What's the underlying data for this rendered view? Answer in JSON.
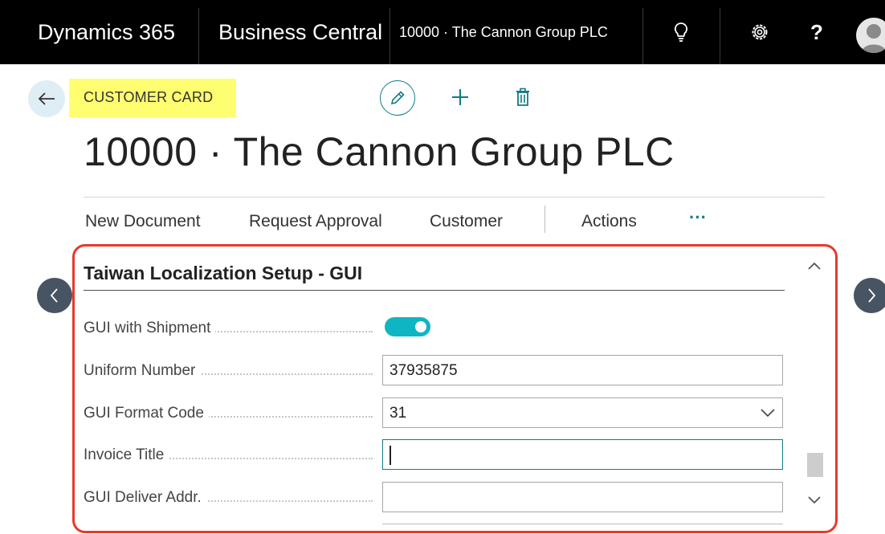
{
  "topbar": {
    "app_name": "Dynamics 365",
    "product_name": "Business Central",
    "company_record": "10000 · The Cannon Group PLC",
    "icons": [
      "lightbulb-icon",
      "gear-icon",
      "help-icon",
      "user-icon"
    ],
    "help_glyph": "?"
  },
  "header": {
    "caption": "CUSTOMER CARD",
    "title": "10000 · The Cannon Group PLC",
    "caption_highlight": "#fffe70"
  },
  "actions": {
    "items": [
      "New Document",
      "Request Approval",
      "Customer",
      "Actions"
    ],
    "more": "···"
  },
  "fasttab": {
    "title": "Taiwan Localization Setup - GUI",
    "fields": [
      {
        "label": "GUI with Shipment",
        "type": "toggle",
        "value": "on"
      },
      {
        "label": "Uniform Number",
        "type": "text",
        "value": "37935875"
      },
      {
        "label": "GUI Format Code",
        "type": "select",
        "value": "31"
      },
      {
        "label": "Invoice Title",
        "type": "text",
        "value": ""
      },
      {
        "label": "GUI Deliver Addr.",
        "type": "text",
        "value": ""
      }
    ]
  },
  "colors": {
    "accent": "#0e7c86",
    "toggle_on": "#10b5c3",
    "panel_border": "#e53a2b",
    "nav_arrow": "#475463"
  }
}
